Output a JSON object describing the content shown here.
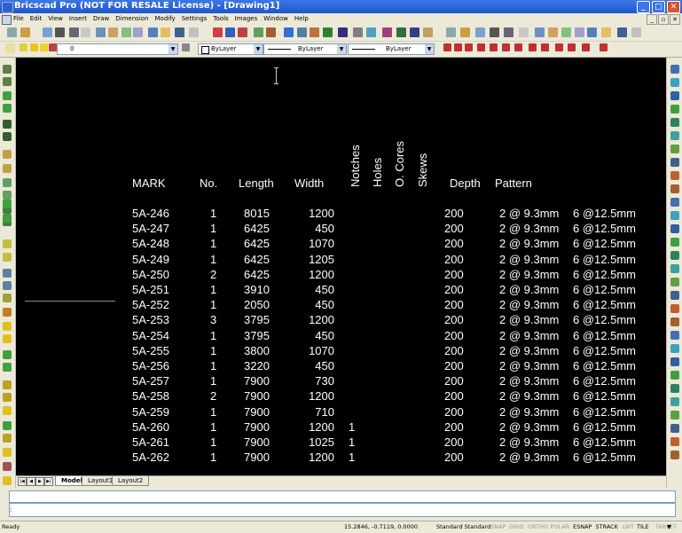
{
  "window": {
    "title": "Bricscad Pro (NOT FOR RESALE License) - [Drawing1]",
    "minimize": "_",
    "maximize": "□",
    "close": "✕"
  },
  "menu": [
    "File",
    "Edit",
    "View",
    "Insert",
    "Draw",
    "Dimension",
    "Modify",
    "Settings",
    "Tools",
    "Images",
    "Window",
    "Help"
  ],
  "toolbar2": {
    "layer_value": "0",
    "color_value": "ByLayer",
    "linetype_value": "ByLayer",
    "lineweight_value": "ByLayer"
  },
  "table": {
    "headers": {
      "mark": "MARK",
      "no": "No.",
      "length": "Length",
      "width": "Width",
      "depth": "Depth",
      "pattern": "Pattern"
    },
    "vertical_headers": [
      "Notches",
      "Holes",
      "O. Cores",
      "Skews"
    ],
    "rows": [
      {
        "mark": "5A-246",
        "no": "1",
        "length": "8015",
        "width": "1200",
        "notches": "",
        "depth": "200",
        "p1": "2 @ 9.3mm",
        "p2": "6 @12.5mm"
      },
      {
        "mark": "5A-247",
        "no": "1",
        "length": "6425",
        "width": "450",
        "notches": "",
        "depth": "200",
        "p1": "2 @ 9.3mm",
        "p2": "6 @12.5mm"
      },
      {
        "mark": "5A-248",
        "no": "1",
        "length": "6425",
        "width": "1070",
        "notches": "",
        "depth": "200",
        "p1": "2 @ 9.3mm",
        "p2": "6 @12.5mm"
      },
      {
        "mark": "5A-249",
        "no": "1",
        "length": "6425",
        "width": "1205",
        "notches": "",
        "depth": "200",
        "p1": "2 @ 9.3mm",
        "p2": "6 @12.5mm"
      },
      {
        "mark": "5A-250",
        "no": "2",
        "length": "6425",
        "width": "1200",
        "notches": "",
        "depth": "200",
        "p1": "2 @ 9.3mm",
        "p2": "6 @12.5mm"
      },
      {
        "mark": "5A-251",
        "no": "1",
        "length": "3910",
        "width": "450",
        "notches": "",
        "depth": "200",
        "p1": "2 @ 9.3mm",
        "p2": "6 @12.5mm"
      },
      {
        "mark": "5A-252",
        "no": "1",
        "length": "2050",
        "width": "450",
        "notches": "",
        "depth": "200",
        "p1": "2 @ 9.3mm",
        "p2": "6 @12.5mm"
      },
      {
        "mark": "5A-253",
        "no": "3",
        "length": "3795",
        "width": "1200",
        "notches": "",
        "depth": "200",
        "p1": "2 @ 9.3mm",
        "p2": "6 @12.5mm"
      },
      {
        "mark": "5A-254",
        "no": "1",
        "length": "3795",
        "width": "450",
        "notches": "",
        "depth": "200",
        "p1": "2 @ 9.3mm",
        "p2": "6 @12.5mm"
      },
      {
        "mark": "5A-255",
        "no": "1",
        "length": "3800",
        "width": "1070",
        "notches": "",
        "depth": "200",
        "p1": "2 @ 9.3mm",
        "p2": "6 @12.5mm"
      },
      {
        "mark": "5A-256",
        "no": "1",
        "length": "3220",
        "width": "450",
        "notches": "",
        "depth": "200",
        "p1": "2 @ 9.3mm",
        "p2": "6 @12.5mm"
      },
      {
        "mark": "5A-257",
        "no": "1",
        "length": "7900",
        "width": "730",
        "notches": "",
        "depth": "200",
        "p1": "2 @ 9.3mm",
        "p2": "6 @12.5mm"
      },
      {
        "mark": "5A-258",
        "no": "2",
        "length": "7900",
        "width": "1200",
        "notches": "",
        "depth": "200",
        "p1": "2 @ 9.3mm",
        "p2": "6 @12.5mm"
      },
      {
        "mark": "5A-259",
        "no": "1",
        "length": "7900",
        "width": "710",
        "notches": "",
        "depth": "200",
        "p1": "2 @ 9.3mm",
        "p2": "6 @12.5mm"
      },
      {
        "mark": "5A-260",
        "no": "1",
        "length": "7900",
        "width": "1200",
        "notches": "1",
        "depth": "200",
        "p1": "2 @ 9.3mm",
        "p2": "6 @12.5mm"
      },
      {
        "mark": "5A-261",
        "no": "1",
        "length": "7900",
        "width": "1025",
        "notches": "1",
        "depth": "200",
        "p1": "2 @ 9.3mm",
        "p2": "6 @12.5mm"
      },
      {
        "mark": "5A-262",
        "no": "1",
        "length": "7900",
        "width": "1200",
        "notches": "1",
        "depth": "200",
        "p1": "2 @ 9.3mm",
        "p2": "6 @12.5mm"
      }
    ]
  },
  "tabs": [
    "Model",
    "Layout1",
    "Layout2"
  ],
  "command": {
    "prompt": ":"
  },
  "status": {
    "ready": "Ready",
    "coords": "15.2846, -0.7119, 0.0000",
    "styles": "Standard  Standard",
    "flags": [
      {
        "label": "SNAP",
        "on": false
      },
      {
        "label": "GRID",
        "on": false
      },
      {
        "label": "ORTHO",
        "on": false
      },
      {
        "label": "POLAR",
        "on": false
      },
      {
        "label": "ESNAP",
        "on": true
      },
      {
        "label": "STRACK",
        "on": true
      },
      {
        "label": "LWT",
        "on": false
      },
      {
        "label": "TILE",
        "on": true
      },
      {
        "label": "TABLET",
        "on": false
      }
    ]
  }
}
